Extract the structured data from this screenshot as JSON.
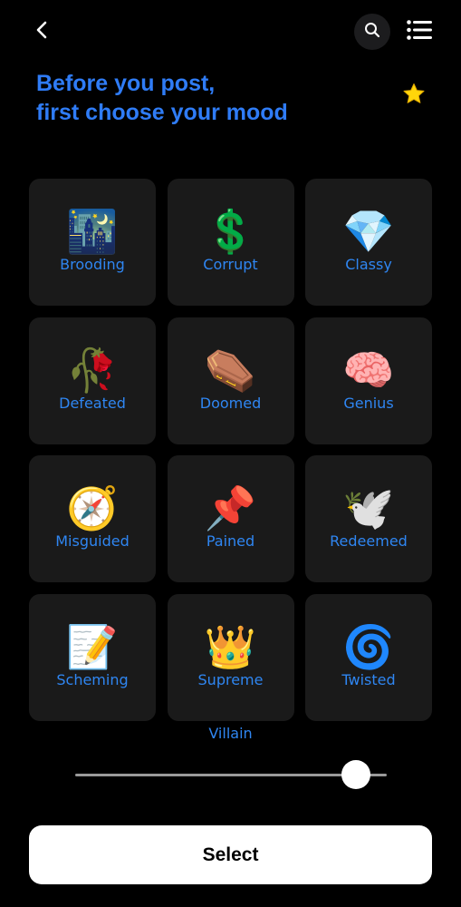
{
  "header": {
    "back_icon": "chevron-left-icon",
    "search_icon": "search-icon",
    "menu_icon": "list-icon",
    "favorite_icon": "star-icon"
  },
  "headline": {
    "line1": "Before you post,",
    "line2": "first choose your mood"
  },
  "moods": [
    {
      "label": "Brooding",
      "emoji": "🌃"
    },
    {
      "label": "Corrupt",
      "emoji": "💲"
    },
    {
      "label": "Classy",
      "emoji": "💎"
    },
    {
      "label": "Defeated",
      "emoji": "🥀"
    },
    {
      "label": "Doomed",
      "emoji": "⚰️"
    },
    {
      "label": "Genius",
      "emoji": "🧠"
    },
    {
      "label": "Misguided",
      "emoji": "🧭"
    },
    {
      "label": "Pained",
      "emoji": "📌"
    },
    {
      "label": "Redeemed",
      "emoji": "🕊️"
    },
    {
      "label": "Scheming",
      "emoji": "📝"
    },
    {
      "label": "Supreme",
      "emoji": "👑"
    },
    {
      "label": "Twisted",
      "emoji": "🌀"
    }
  ],
  "slider": {
    "label": "Villain",
    "level": 0.9
  },
  "select_button": {
    "label": "Select"
  },
  "colors": {
    "accent": "#2f7cf6",
    "label": "#2f86f2",
    "tile_bg": "#1a1a1a",
    "star": "#ffd60a"
  }
}
